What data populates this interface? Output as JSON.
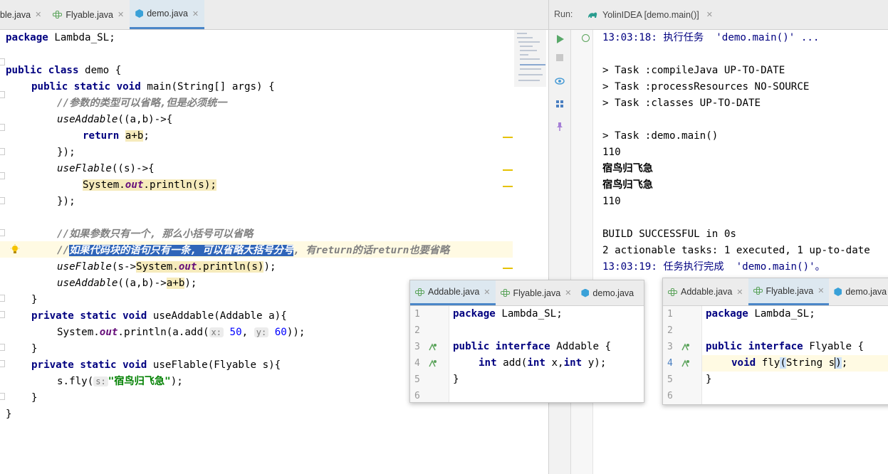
{
  "editor_tabs": [
    {
      "label": "ble.java",
      "icon": "interface-icon",
      "active": false
    },
    {
      "label": "Flyable.java",
      "icon": "interface-icon",
      "active": false
    },
    {
      "label": "demo.java",
      "icon": "class-icon",
      "active": true
    }
  ],
  "editor": {
    "l1": {
      "kw": "package",
      "rest": " Lambda_SL;"
    },
    "l3": {
      "kw": "public class",
      "rest": " demo {"
    },
    "l4": {
      "kw": "public static void",
      "rest": " main(String[] args) {"
    },
    "l5": {
      "comment": "//参数的类型可以省略,但是必须统一"
    },
    "l6": {
      "call": "useAddable",
      "rest": "((a,b)->{"
    },
    "l7": {
      "kw": "return",
      "expr": "a+b",
      "end": ";"
    },
    "l8": {
      "text": "});"
    },
    "l9": {
      "call": "useFlable",
      "rest": "((s)->{"
    },
    "l10": {
      "a": "System.",
      "field": "out",
      "b": ".println(s);"
    },
    "l11": {
      "text": "});"
    },
    "l13": {
      "comment": "//如果参数只有一个, 那么小括号可以省略"
    },
    "l14": {
      "slashes": "//",
      "selected": "如果代码块的语句只有一条, 可以省略大括号分号",
      "rest": ", 有return的话return也要省略"
    },
    "l15": {
      "call": "useFlable",
      "a": "(s->",
      "hl_a": "System.",
      "field": "out",
      "hl_b": ".println(s)",
      "b": ");"
    },
    "l16": {
      "call": "useAddable",
      "a": "((a,b)->",
      "hl": "a+b",
      "b": ");"
    },
    "l17": {
      "text": "}"
    },
    "l18": {
      "kw": "private static void",
      "rest": " useAddable(Addable a){"
    },
    "l19": {
      "a": "System.",
      "field": "out",
      "b": ".println(a.add(",
      "hint_x": "x:",
      "n1": "50",
      "c": ", ",
      "hint_y": "y:",
      "n2": "60",
      "d": "));"
    },
    "l20": {
      "text": "}"
    },
    "l21": {
      "kw": "private static void",
      "rest": " useFlable(Flyable s){"
    },
    "l22": {
      "a": "s.fly(",
      "hint_s": "s:",
      "str": "\"宿鸟归飞急\"",
      "b": ");"
    },
    "l23": {
      "text": "}"
    },
    "l24": {
      "text": "}"
    }
  },
  "run": {
    "label": "Run:",
    "tab": "YolinIDEA [demo.main()]",
    "console": [
      "13:03:18: 执行任务  'demo.main()' ...",
      "",
      "> Task :compileJava UP-TO-DATE",
      "> Task :processResources NO-SOURCE",
      "> Task :classes UP-TO-DATE",
      "",
      "> Task :demo.main()",
      "110",
      "宿鸟归飞急",
      "宿鸟归飞急",
      "110",
      "",
      "BUILD SUCCESSFUL in 0s",
      "2 actionable tasks: 1 executed, 1 up-to-date",
      "13:03:19: 任务执行完成  'demo.main()'。"
    ]
  },
  "popup_addable": {
    "tabs": [
      {
        "label": "Addable.java",
        "icon": "interface-icon",
        "active": true
      },
      {
        "label": "Flyable.java",
        "icon": "interface-icon",
        "active": false
      },
      {
        "label": "demo.java",
        "icon": "class-icon",
        "active": false
      }
    ],
    "line_numbers": [
      "1",
      "2",
      "3",
      "4",
      "5",
      "6"
    ],
    "l1": {
      "kw": "package",
      "rest": " Lambda_SL;"
    },
    "l3": {
      "kw": "public interface",
      "rest": " Addable {"
    },
    "l4": {
      "kw1": "int",
      "a": " add(",
      "kw2": "int",
      "b": " x,",
      "kw3": "int",
      "c": " y);"
    },
    "l5": {
      "text": "}"
    }
  },
  "popup_flyable": {
    "tabs": [
      {
        "label": "Addable.java",
        "icon": "interface-icon",
        "active": false
      },
      {
        "label": "Flyable.java",
        "icon": "interface-icon",
        "active": true
      },
      {
        "label": "demo.java",
        "icon": "class-icon",
        "active": false
      }
    ],
    "line_numbers": [
      "1",
      "2",
      "3",
      "4",
      "5",
      "6"
    ],
    "l1": {
      "kw": "package",
      "rest": " Lambda_SL;"
    },
    "l3": {
      "kw": "public interface",
      "rest": " Flyable {"
    },
    "l4": {
      "kw": "void",
      "a": " fly",
      "b": "String s",
      "c": ";"
    },
    "l5": {
      "text": "}"
    }
  },
  "colors": {
    "keyword": "#000080",
    "comment": "#808080",
    "string": "#008000",
    "field": "#660e7a",
    "selection": "#2f65b9",
    "active_tab": "#4a86c8"
  }
}
